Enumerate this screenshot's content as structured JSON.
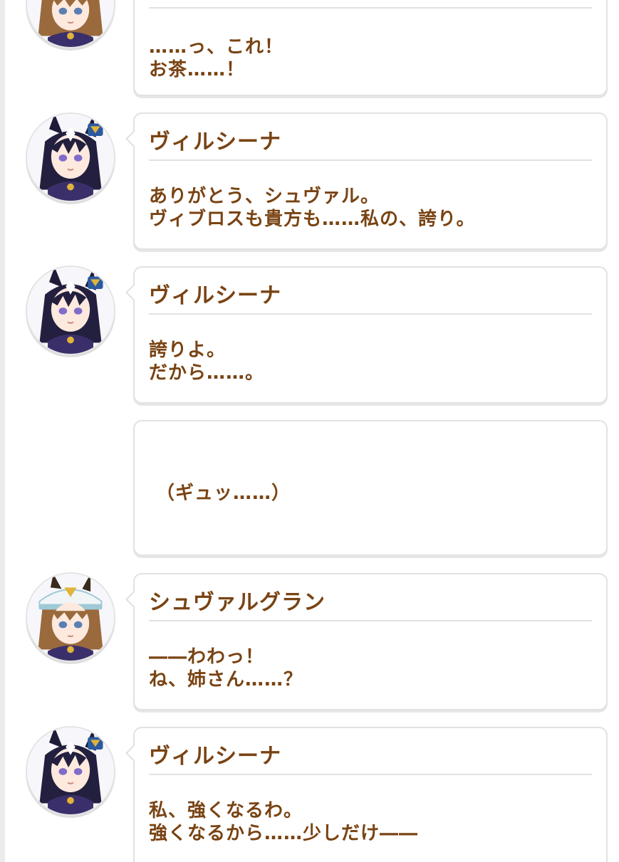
{
  "colors": {
    "text": "#794313",
    "bubble_border": "#e2e2e2",
    "divider": "#e2e2e2"
  },
  "messages": [
    {
      "speaker": "",
      "avatar": "schwarzgran-avatar",
      "lines": [
        "……っ、これ！",
        "お茶……！"
      ]
    },
    {
      "speaker": "ヴィルシーナ",
      "avatar": "verxina-avatar",
      "lines": [
        "ありがとう、シュヴァル。",
        "ヴィブロスも貴方も……私の、誇り。"
      ]
    },
    {
      "speaker": "ヴィルシーナ",
      "avatar": "verxina-avatar",
      "lines": [
        "誇りよ。",
        "だから……。"
      ]
    },
    {
      "narration": "（ギュッ……）"
    },
    {
      "speaker": "シュヴァルグラン",
      "avatar": "schwarzgran-avatar",
      "lines": [
        "――わわっ！",
        "ね、姉さん……？"
      ]
    },
    {
      "speaker": "ヴィルシーナ",
      "avatar": "verxina-avatar",
      "lines": [
        "私、強くなるわ。",
        "強くなるから……少しだけ――"
      ]
    }
  ]
}
